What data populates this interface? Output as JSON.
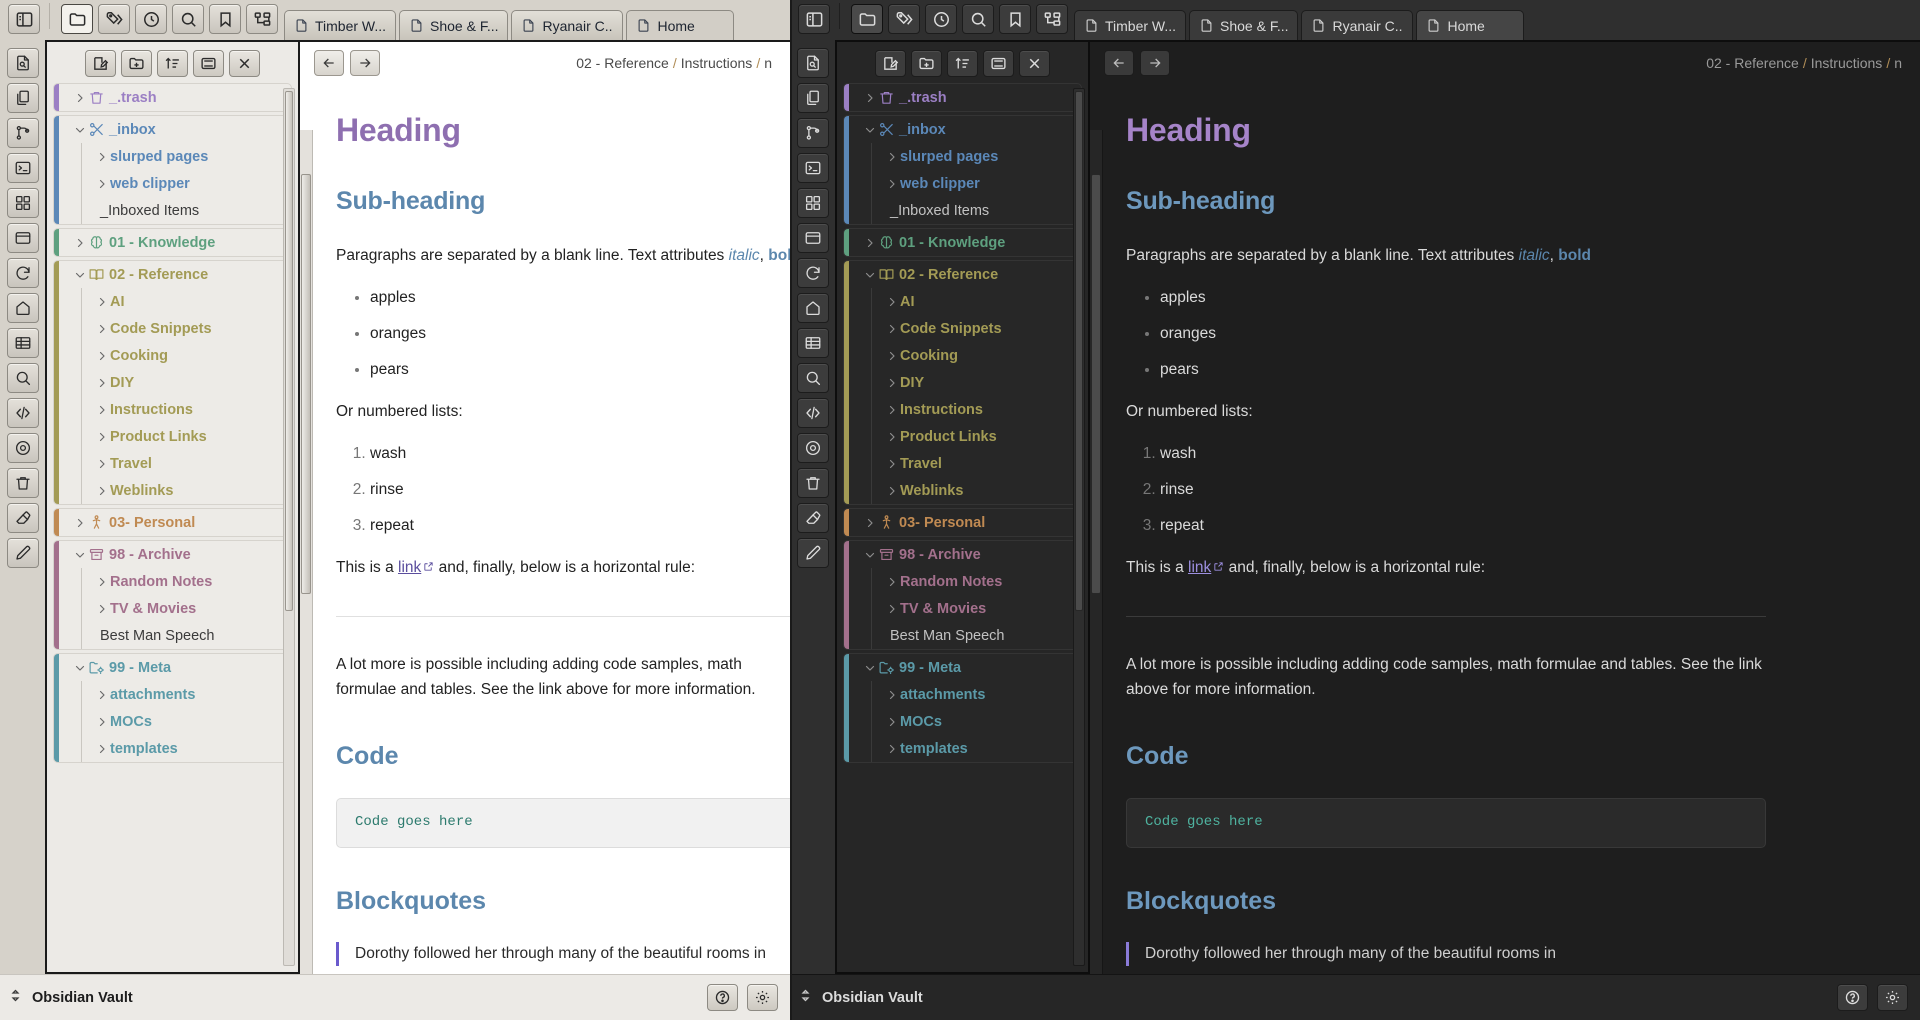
{
  "app": {
    "name": "Obsidian",
    "vault_name": "Obsidian Vault"
  },
  "tabs": [
    {
      "label": "Timber W...",
      "icon": "document-icon",
      "active": false
    },
    {
      "label": "Shoe & F...",
      "icon": "document-icon",
      "active": false
    },
    {
      "label": "Ryanair C...",
      "icon": "document-icon",
      "active": false
    },
    {
      "label": "Home",
      "icon": "document-icon",
      "active": true
    }
  ],
  "top_ribbon": [
    {
      "name": "toggle-left-sidebar-icon",
      "label": "Toggle left sidebar"
    },
    {
      "name": "folder-icon",
      "label": "Files",
      "active": true
    },
    {
      "name": "tags-icon",
      "label": "Tags"
    },
    {
      "name": "clock-icon",
      "label": "Recent files"
    },
    {
      "name": "search-icon",
      "label": "Search"
    },
    {
      "name": "bookmark-icon",
      "label": "Bookmarks"
    },
    {
      "name": "file-tree-icon",
      "label": "Outline"
    }
  ],
  "side_ribbon": [
    {
      "name": "file-search-icon",
      "label": "Quick switcher"
    },
    {
      "name": "copy-file-icon",
      "label": "Duplicate note"
    },
    {
      "name": "git-branch-icon",
      "label": "Version control"
    },
    {
      "name": "terminal-icon",
      "label": "Terminal"
    },
    {
      "name": "grid-icon",
      "label": "Canvas"
    },
    {
      "name": "window-icon",
      "label": "Workspaces"
    },
    {
      "name": "refresh-icon",
      "label": "Sync"
    },
    {
      "name": "home-icon",
      "label": "Home"
    },
    {
      "name": "table-icon",
      "label": "Database"
    },
    {
      "name": "search-circle-icon",
      "label": "Search"
    },
    {
      "name": "code-icon",
      "label": "Code"
    },
    {
      "name": "target-icon",
      "label": "Focus"
    },
    {
      "name": "trash-icon",
      "label": "Trash"
    },
    {
      "name": "eraser-icon",
      "label": "Clear"
    },
    {
      "name": "pen-icon",
      "label": "Draw"
    }
  ],
  "explorer_toolbar": [
    {
      "name": "new-note-icon",
      "label": "New note"
    },
    {
      "name": "new-folder-icon",
      "label": "New folder"
    },
    {
      "name": "sort-icon",
      "label": "Change sort order"
    },
    {
      "name": "collapse-icon",
      "label": "Collapse all"
    },
    {
      "name": "close-icon",
      "label": "Close"
    }
  ],
  "status_bar": {
    "swap_icon": "swap-vertical-icon",
    "vault_label": "Obsidian Vault",
    "help_icon": "help-icon",
    "settings_icon": "gear-icon"
  },
  "file_tree": [
    {
      "label": "_.trash",
      "icon": "trash-icon",
      "accent": "#9b7fc4",
      "expanded": false,
      "children": []
    },
    {
      "label": "_inbox",
      "icon": "scissors-icon",
      "accent": "#5b88b8",
      "expanded": true,
      "children": [
        {
          "label": "slurped pages",
          "type": "folder",
          "expanded": false
        },
        {
          "label": "web clipper",
          "type": "folder",
          "expanded": false
        },
        {
          "label": "_Inboxed Items",
          "type": "file"
        }
      ]
    },
    {
      "label": "01 - Knowledge",
      "icon": "brain-icon",
      "accent": "#5ea07f",
      "expanded": false,
      "children": []
    },
    {
      "label": "02 - Reference",
      "icon": "book-icon",
      "accent": "#a39b55",
      "expanded": true,
      "children": [
        {
          "label": "AI",
          "type": "folder",
          "expanded": false
        },
        {
          "label": "Code Snippets",
          "type": "folder",
          "expanded": false
        },
        {
          "label": "Cooking",
          "type": "folder",
          "expanded": false
        },
        {
          "label": "DIY",
          "type": "folder",
          "expanded": false
        },
        {
          "label": "Instructions",
          "type": "folder",
          "expanded": false
        },
        {
          "label": "Product Links",
          "type": "folder",
          "expanded": false
        },
        {
          "label": "Travel",
          "type": "folder",
          "expanded": false
        },
        {
          "label": "Weblinks",
          "type": "folder",
          "expanded": false
        }
      ]
    },
    {
      "label": "03- Personal",
      "icon": "person-icon",
      "accent": "#c08a52",
      "expanded": false,
      "children": []
    },
    {
      "label": "98 - Archive",
      "icon": "archive-icon",
      "accent": "#a3708c",
      "expanded": true,
      "children": [
        {
          "label": "Random Notes",
          "type": "folder",
          "expanded": false
        },
        {
          "label": "TV & Movies",
          "type": "folder",
          "expanded": false
        },
        {
          "label": "Best Man Speech",
          "type": "file"
        }
      ]
    },
    {
      "label": "99 - Meta",
      "icon": "folder-cog-icon",
      "accent": "#5b9aa8",
      "expanded": true,
      "children": [
        {
          "label": "attachments",
          "type": "folder",
          "expanded": false
        },
        {
          "label": "MOCs",
          "type": "folder",
          "expanded": false
        },
        {
          "label": "templates",
          "type": "folder",
          "expanded": false
        }
      ]
    }
  ],
  "note": {
    "back_icon": "arrow-left-icon",
    "forward_icon": "arrow-right-icon",
    "breadcrumb_parts": [
      "02 - Reference",
      "Instructions",
      "n"
    ],
    "heading": "Heading",
    "subheading": "Sub-heading",
    "paragraph_1_prefix": "Paragraphs are separated by a blank line. Text attributes ",
    "paragraph_1_italic": "italic",
    "paragraph_1_comma": ", ",
    "paragraph_1_bold": "bold",
    "bullet_list": [
      "apples",
      "oranges",
      "pears"
    ],
    "numbered_intro": "Or numbered lists:",
    "numbered_list": [
      "wash",
      "rinse",
      "repeat"
    ],
    "link_line_prefix": "This is a ",
    "link_text": "link",
    "link_icon": "external-link-icon",
    "link_line_suffix": " and, finally, below is a horizontal rule:",
    "paragraph_2": "A lot more is possible including adding code samples, math formulae and tables. See the link above for more information.",
    "code_heading": "Code",
    "code_content": "Code goes here",
    "blockquote_heading": "Blockquotes",
    "blockquote_text": "Dorothy followed her through many of the beautiful rooms in"
  },
  "colors": {
    "h1": "#8e6fb0",
    "h2": "#5c87ad",
    "link": "#5b4e9e",
    "code": "#2c7a6d",
    "breadcrumb_sep": "#b08d57"
  }
}
